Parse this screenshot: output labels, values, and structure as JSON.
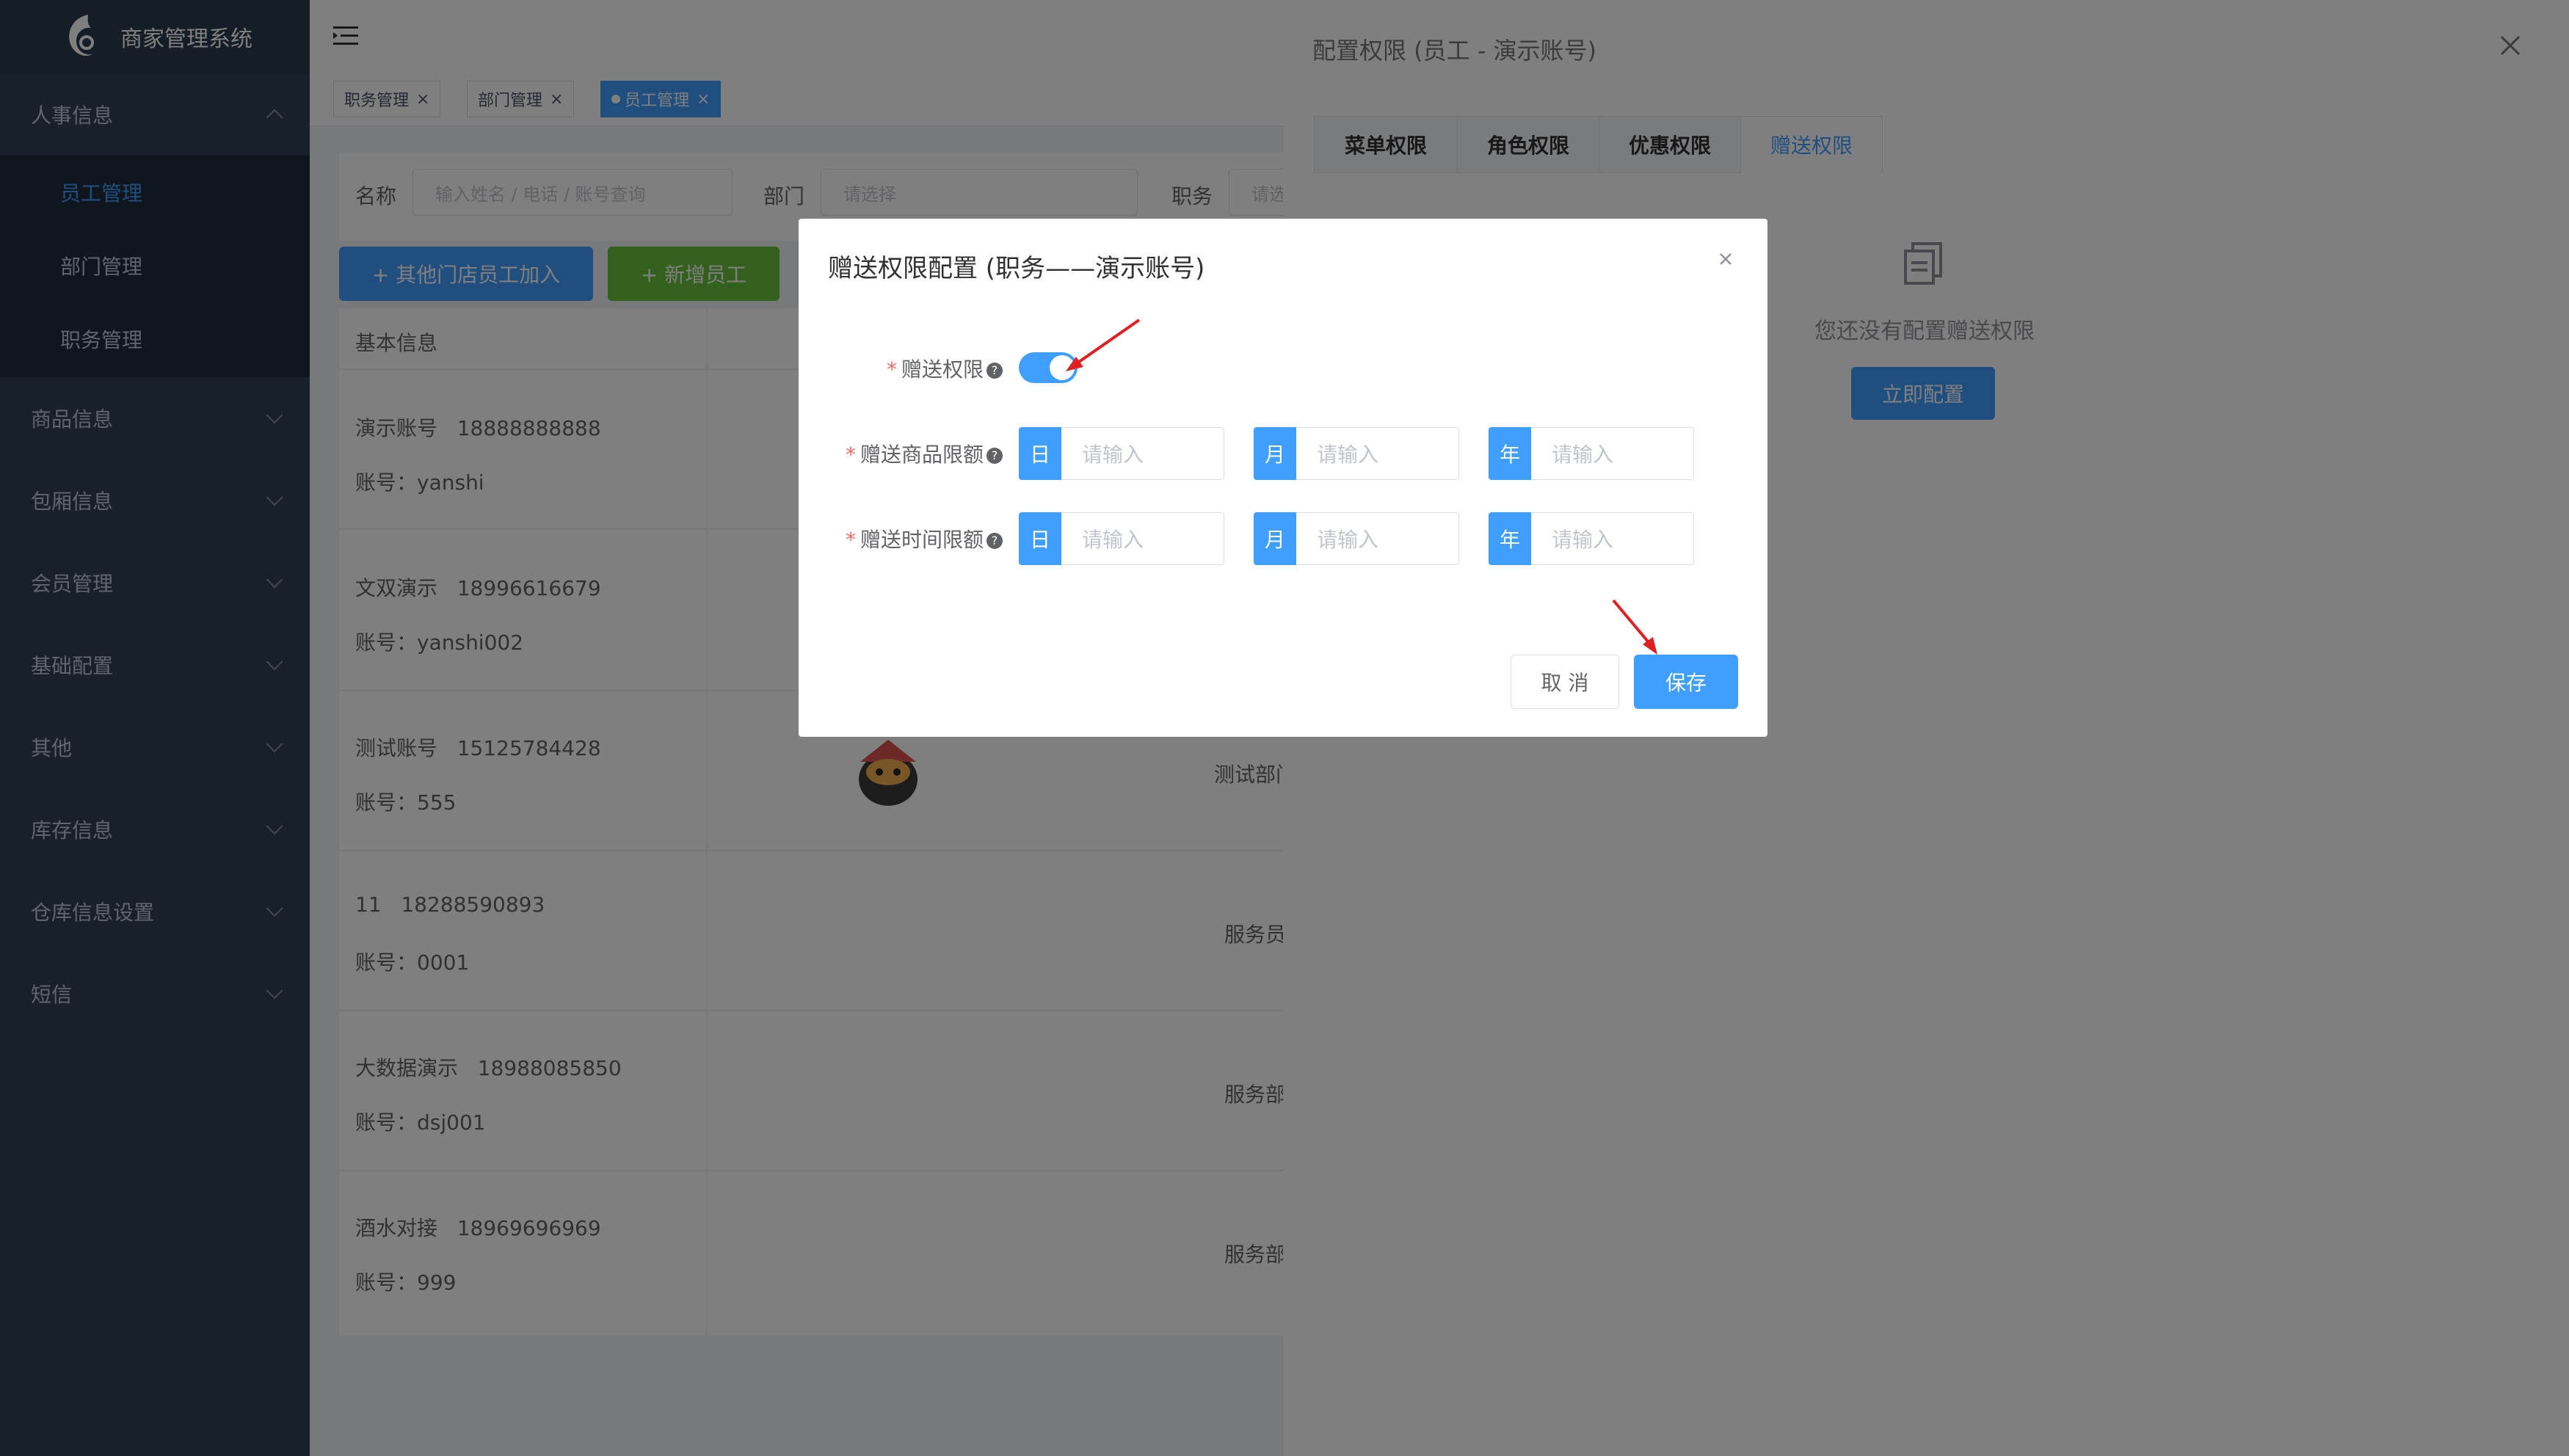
{
  "app": {
    "title": "商家管理系统"
  },
  "sidebar": {
    "groups": [
      {
        "label": "人事信息"
      },
      {
        "label": "商品信息"
      },
      {
        "label": "包厢信息"
      },
      {
        "label": "会员管理"
      },
      {
        "label": "基础配置"
      },
      {
        "label": "其他"
      },
      {
        "label": "库存信息"
      },
      {
        "label": "仓库信息设置"
      },
      {
        "label": "短信"
      }
    ],
    "sub_items": [
      {
        "label": "员工管理"
      },
      {
        "label": "部门管理"
      },
      {
        "label": "职务管理"
      }
    ]
  },
  "tags": [
    {
      "label": "职务管理"
    },
    {
      "label": "部门管理"
    },
    {
      "label": "员工管理"
    }
  ],
  "search": {
    "name_label": "名称",
    "name_placeholder": "输入姓名 / 电话 / 账号查询",
    "dept_label": "部门",
    "dept_placeholder": "请选择",
    "role_label": "职务",
    "role_placeholder": "请选"
  },
  "actions": {
    "add_other_store": "+ 其他门店员工加入",
    "add_employee": "+ 新增员工"
  },
  "table": {
    "header_basic": "基本信息",
    "rows": [
      {
        "name": "演示账号",
        "phone": "18888888888",
        "account": "账号：yanshi",
        "dept": ""
      },
      {
        "name": "文双演示",
        "phone": "18996616679",
        "account": "账号：yanshi002",
        "dept": ""
      },
      {
        "name": "测试账号",
        "phone": "15125784428",
        "account": "账号：555",
        "dept": "测试部门"
      },
      {
        "name": "11",
        "phone": "18288590893",
        "account": "账号：0001",
        "dept": "服务员"
      },
      {
        "name": "大数据演示",
        "phone": "18988085850",
        "account": "账号：dsj001",
        "dept": "服务部"
      },
      {
        "name": "酒水对接",
        "phone": "18969696969",
        "account": "账号：999",
        "dept": "服务部"
      }
    ]
  },
  "drawer": {
    "title": "配置权限 (员工 - 演示账号)",
    "tabs": [
      {
        "label": "菜单权限"
      },
      {
        "label": "角色权限"
      },
      {
        "label": "优惠权限"
      },
      {
        "label": "赠送权限"
      }
    ],
    "empty_text": "您还没有配置赠送权限",
    "config_button": "立即配置"
  },
  "dialog": {
    "title": "赠送权限配置 (职务——演示账号)",
    "switch_label": "赠送权限",
    "switch_on": true,
    "goods_label": "赠送商品限额",
    "time_label": "赠送时间限额",
    "prefix_day": "日",
    "prefix_month": "月",
    "prefix_year": "年",
    "placeholder": "请输入",
    "cancel": "取 消",
    "save": "保存"
  },
  "colors": {
    "primary": "#409eff",
    "success": "#67c23a",
    "sidebar": "#304156",
    "danger": "#f56c6c"
  }
}
